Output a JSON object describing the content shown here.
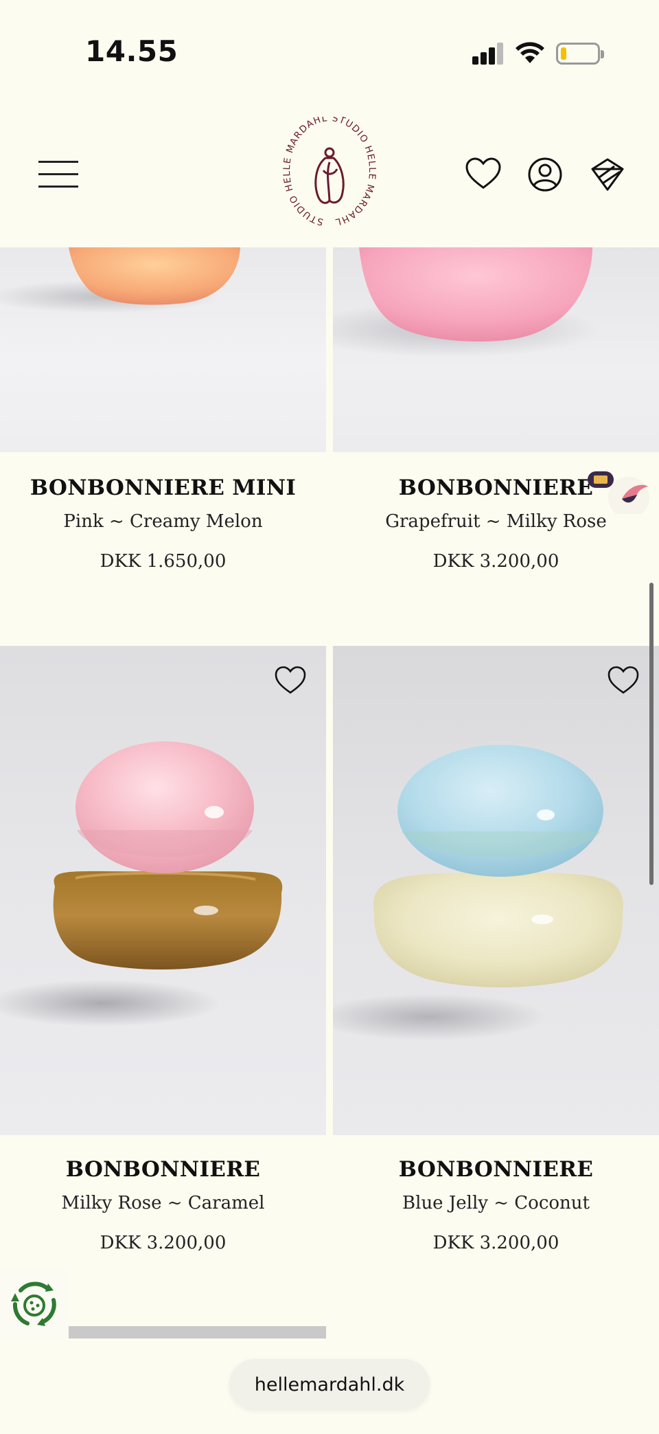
{
  "status_bar": {
    "time": "14.55",
    "signal_icon": "cellular-signal-icon",
    "wifi_icon": "wifi-icon",
    "battery_icon": "battery-low-icon"
  },
  "header": {
    "menu_icon": "hamburger-menu-icon",
    "logo_text": "STUDIO HELLE MARDAHL",
    "wishlist_icon": "heart-icon",
    "account_icon": "user-icon",
    "cart_icon": "shopping-bag-icon"
  },
  "products": [
    {
      "name": "BONBONNIERE MINI",
      "variant": "Pink ~ Creamy Melon",
      "price": "DKK 1.650,00"
    },
    {
      "name": "BONBONNIERE",
      "variant": "Grapefruit ~ Milky Rose",
      "price": "DKK 3.200,00"
    },
    {
      "name": "BONBONNIERE",
      "variant": "Milky Rose ~ Caramel",
      "price": "DKK 3.200,00"
    },
    {
      "name": "BONBONNIERE",
      "variant": "Blue Jelly ~ Coconut",
      "price": "DKK 3.200,00"
    }
  ],
  "browser": {
    "url": "hellemardahl.dk"
  },
  "colors": {
    "background": "#fcfcf1",
    "logo": "#6b1a2c",
    "text": "#111111"
  }
}
